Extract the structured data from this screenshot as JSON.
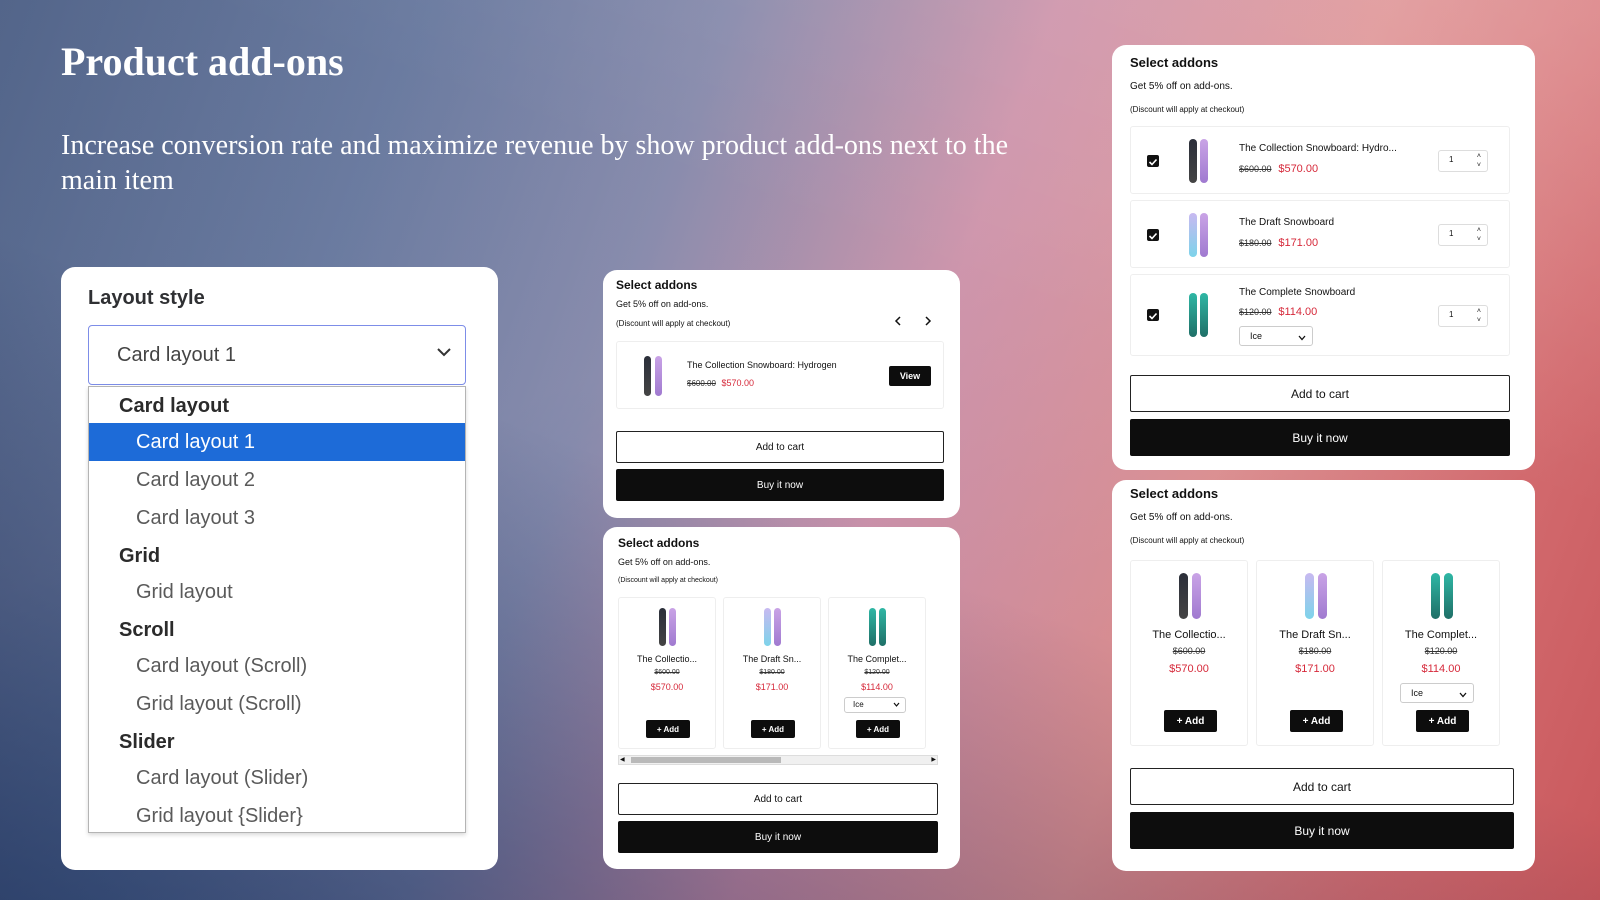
{
  "hero": {
    "title": "Product add-ons",
    "subtitle": "Increase conversion rate and maximize revenue by show product add-ons next to the main item"
  },
  "layout_panel": {
    "label": "Layout style",
    "selected": "Card layout 1",
    "groups": [
      {
        "label": "Card layout",
        "options": [
          "Card layout 1",
          "Card layout 2",
          "Card layout 3"
        ]
      },
      {
        "label": "Grid",
        "options": [
          "Grid layout"
        ]
      },
      {
        "label": "Scroll",
        "options": [
          "Card layout (Scroll)",
          "Grid layout (Scroll)"
        ]
      },
      {
        "label": "Slider",
        "options": [
          "Card layout (Slider)",
          "Grid layout {Slider}"
        ]
      }
    ]
  },
  "widget": {
    "title": "Select addons",
    "discount_line": "Get 5% off on add-ons.",
    "discount_note": "(Discount will apply at checkout)",
    "add_to_cart": "Add to cart",
    "buy_now": "Buy it now",
    "add_label": "+ Add",
    "view_label": "View",
    "variant_value": "Ice"
  },
  "slider_card": {
    "product": "The Collection Snowboard: Hydrogen",
    "old_price": "$600.00",
    "new_price": "$570.00",
    "prev_icon": "chevron-left-icon",
    "next_icon": "chevron-right-icon"
  },
  "products": [
    {
      "name": "The Collection Snowboard: Hydrogen",
      "short_scroll": "The Collectio...",
      "short_grid": "The Collectio...",
      "old_price": "$600.00",
      "new_price": "$570.00",
      "list_name": "The Collection Snowboard: Hydro...",
      "qty": "1"
    },
    {
      "name": "The Draft Snowboard",
      "short_scroll": "The Draft Sn...",
      "short_grid": "The Draft Sn...",
      "old_price": "$180.00",
      "new_price": "$171.00",
      "list_name": "The Draft Snowboard",
      "qty": "1"
    },
    {
      "name": "The Complete Snowboard",
      "short_scroll": "The Complet...",
      "short_grid": "The Complet...",
      "old_price": "$120.00",
      "new_price": "$114.00",
      "list_name": "The Complete Snowboard",
      "qty": "1"
    }
  ],
  "colors": {
    "accent": "#1d6bd8",
    "sale": "#d6293a",
    "button_black": "#0d0d0d"
  }
}
